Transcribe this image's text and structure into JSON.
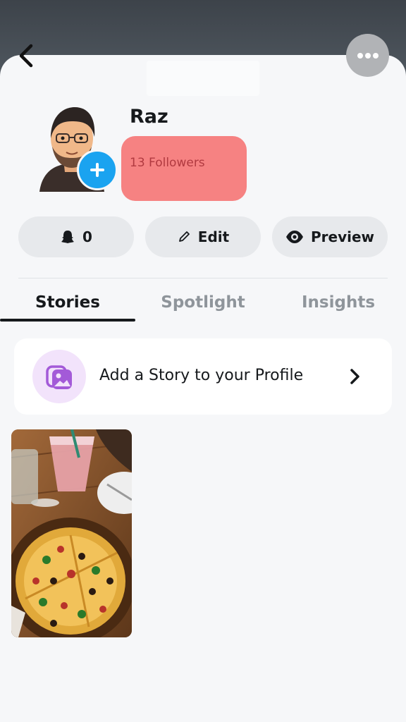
{
  "profile": {
    "name": "Raz",
    "followers": "13 Followers"
  },
  "actions": {
    "snapscore": "0",
    "edit": "Edit",
    "preview": "Preview"
  },
  "tabs": [
    "Stories",
    "Spotlight",
    "Insights"
  ],
  "add_story": {
    "label": "Add a Story to your Profile"
  },
  "colors": {
    "accent_blue": "#1aa3f0",
    "followers_highlight": "#f68282",
    "story_icon": "#a35ad8"
  }
}
